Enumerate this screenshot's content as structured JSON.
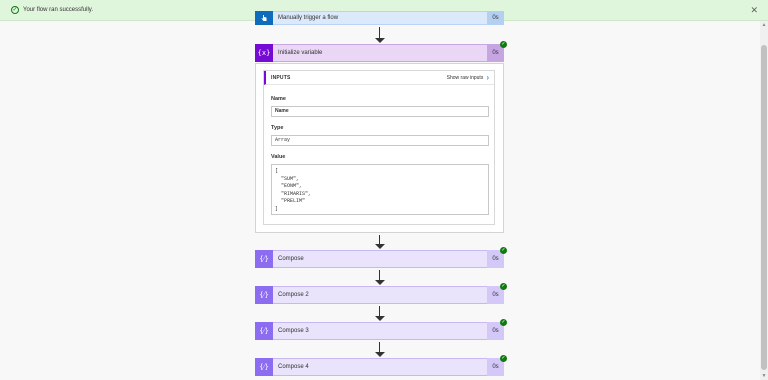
{
  "banner": {
    "message": "Your flow ran successfully.",
    "close_glyph": "✕",
    "ok_glyph": "✓"
  },
  "steps": {
    "trigger": {
      "title": "Manually trigger a flow",
      "duration": "0s",
      "icon": "hand-pointer-icon"
    },
    "initialize": {
      "title": "Initialize variable",
      "duration": "0s",
      "icon_text": "{x}",
      "status": "succeeded"
    },
    "compose": [
      {
        "title": "Compose",
        "duration": "0s",
        "icon_text": "{⁄}",
        "status": "succeeded"
      },
      {
        "title": "Compose 2",
        "duration": "0s",
        "icon_text": "{⁄}",
        "status": "succeeded"
      },
      {
        "title": "Compose 3",
        "duration": "0s",
        "icon_text": "{⁄}",
        "status": "succeeded"
      },
      {
        "title": "Compose 4",
        "duration": "0s",
        "icon_text": "{⁄}",
        "status": "succeeded"
      }
    ]
  },
  "inputs": {
    "heading": "INPUTS",
    "show_raw": "Show raw inputs",
    "name_label": "Name",
    "name_value": "Name",
    "type_label": "Type",
    "type_value": "Array",
    "value_label": "Value",
    "value_open": "[",
    "value_items": [
      "\"SUM\",",
      "\"EONM\",",
      "\"RIMARIS\",",
      "\"PRELIM\""
    ],
    "value_close": "]"
  },
  "check_glyph": "✓",
  "colors": {
    "banner_bg": "#dff6dd",
    "success_green": "#107c10",
    "trigger_blue": "#0f6cbd",
    "variable_purple": "#770bd6",
    "compose_purple": "#8c6cf0"
  }
}
